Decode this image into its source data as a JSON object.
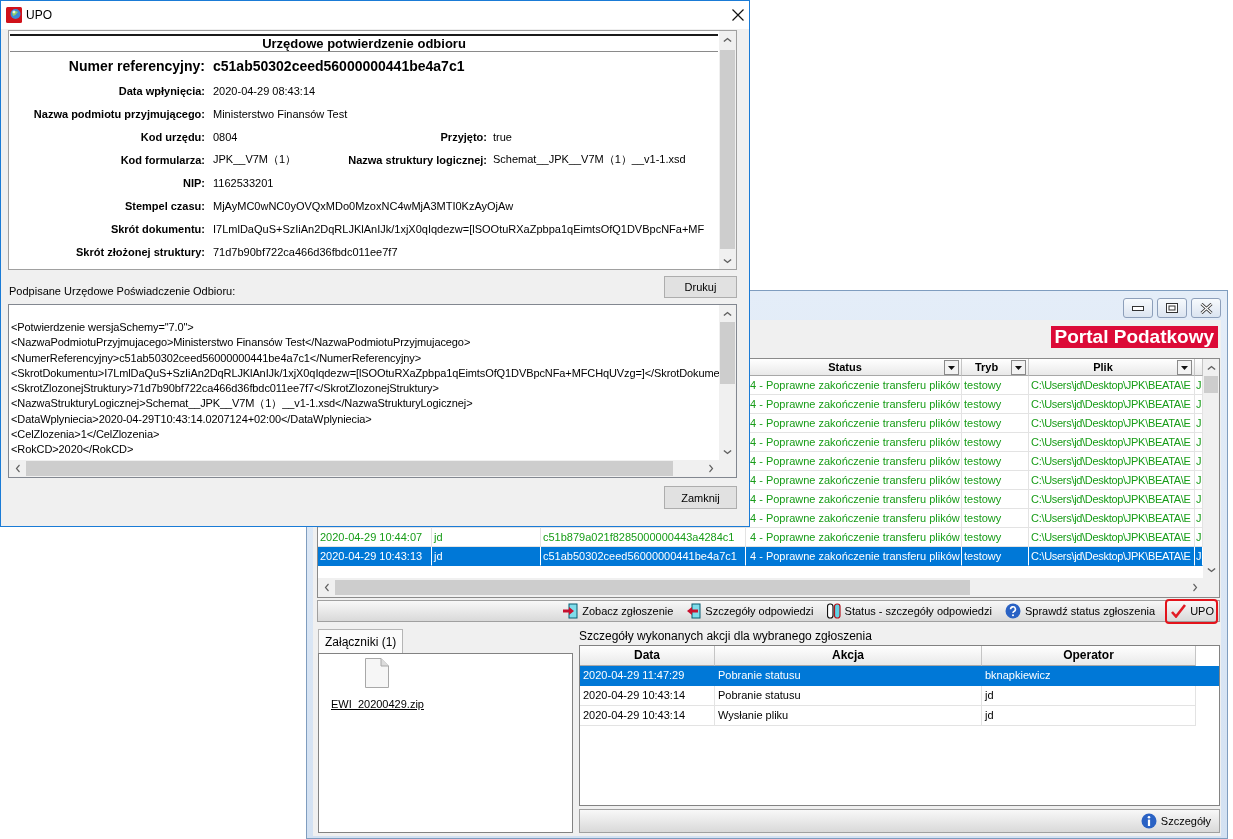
{
  "main_window": {
    "brand": "Portal Podatkowy",
    "submissions": {
      "columns": [
        {
          "label": "Status",
          "filter": true
        },
        {
          "label": "Tryb",
          "filter": true
        },
        {
          "label": "Plik",
          "filter": true
        }
      ],
      "rows": [
        {
          "status": "4 - Poprawne zakończenie transferu plików",
          "tryb": "testowy",
          "plik": "C:\\Users\\jd\\Desktop\\JPK\\BEATA\\E",
          "column_7": "J",
          "selected": false
        },
        {
          "status": "4 - Poprawne zakończenie transferu plików",
          "tryb": "testowy",
          "plik": "C:\\Users\\jd\\Desktop\\JPK\\BEATA\\E",
          "column_7": "J",
          "selected": false
        },
        {
          "status": "4 - Poprawne zakończenie transferu plików",
          "tryb": "testowy",
          "plik": "C:\\Users\\jd\\Desktop\\JPK\\BEATA\\E",
          "column_7": "J",
          "selected": false
        },
        {
          "status": "4 - Poprawne zakończenie transferu plików",
          "tryb": "testowy",
          "plik": "C:\\Users\\jd\\Desktop\\JPK\\BEATA\\E",
          "column_7": "J",
          "selected": false
        },
        {
          "status": "4 - Poprawne zakończenie transferu plików",
          "tryb": "testowy",
          "plik": "C:\\Users\\jd\\Desktop\\JPK\\BEATA\\E",
          "column_7": "J",
          "selected": false
        },
        {
          "status": "4 - Poprawne zakończenie transferu plików",
          "tryb": "testowy",
          "plik": "C:\\Users\\jd\\Desktop\\JPK\\BEATA\\E",
          "column_7": "J",
          "selected": false
        },
        {
          "status": "4 - Poprawne zakończenie transferu plików",
          "tryb": "testowy",
          "plik": "C:\\Users\\jd\\Desktop\\JPK\\BEATA\\E",
          "column_7": "J",
          "selected": false
        },
        {
          "status": "4 - Poprawne zakończenie transferu plików",
          "tryb": "testowy",
          "plik": "C:\\Users\\jd\\Desktop\\JPK\\BEATA\\E",
          "column_7": "J",
          "selected": false
        },
        {
          "column_1": "2020-04-29 10:44:07",
          "column_2": "jd",
          "column_3": "c51b879a021f8285000000443a4284c1",
          "status": "4 - Poprawne zakończenie transferu plików",
          "tryb": "testowy",
          "plik": "C:\\Users\\jd\\Desktop\\JPK\\BEATA\\E",
          "column_7": "J",
          "selected": false
        },
        {
          "column_1": "2020-04-29 10:43:13",
          "column_2": "jd",
          "column_3": "c51ab50302ceed56000000441be4a7c1",
          "status": "4 - Poprawne zakończenie transferu plików",
          "tryb": "testowy",
          "plik": "C:\\Users\\jd\\Desktop\\JPK\\BEATA\\E",
          "column_7": "J",
          "selected": true
        }
      ]
    },
    "actions": [
      {
        "label": "Zobacz zgłoszenie",
        "highlighted": false
      },
      {
        "label": "Szczegóły odpowiedzi",
        "highlighted": false
      },
      {
        "label": "Status - szczegóły odpowiedzi",
        "highlighted": false
      },
      {
        "label": "Sprawdź status zgłoszenia",
        "highlighted": false
      },
      {
        "label": "UPO",
        "highlighted": true
      }
    ],
    "attachments": {
      "tabs": [
        {
          "label": "Załączniki (1)",
          "selected": true
        }
      ],
      "files": [
        "EWI_20200429.zip"
      ]
    },
    "history": {
      "caption": "Szczegóły wykonanych akcji dla wybranego zgłoszenia",
      "columns": [
        "Data",
        "Akcja",
        "Operator"
      ],
      "rows": [
        {
          "data": "2020-04-29 11:47:29",
          "akcja": "Pobranie statusu",
          "operator": "bknapkiewicz",
          "selected": true
        },
        {
          "data": "2020-04-29 10:43:14",
          "akcja": "Pobranie statusu",
          "operator": "jd",
          "selected": false
        },
        {
          "data": "2020-04-29 10:43:14",
          "akcja": "Wysłanie pliku",
          "operator": "jd",
          "selected": false
        }
      ]
    },
    "details_button": "Szczegóły"
  },
  "upo_dialog": {
    "title": "UPO",
    "receipt": {
      "heading": "Urzędowe potwierdzenie odbioru",
      "reference": {
        "label": "Numer referencyjny:",
        "value": "c51ab50302ceed56000000441be4a7c1"
      },
      "fields": [
        {
          "label": "Data wpłynięcia:",
          "value": "2020-04-29 08:43:14"
        },
        {
          "label": "Nazwa podmiotu przyjmującego:",
          "value": "Ministerstwo Finansów Test"
        },
        {
          "label": "Kod urzędu:",
          "value": "0804",
          "second": {
            "label": "Przyjęto:",
            "value": "true"
          }
        },
        {
          "label": "Kod formularza:",
          "value": "JPK__V7M（1）",
          "second": {
            "label": "Nazwa struktury logicznej:",
            "value": "Schemat__JPK__V7M（1）__v1-1.xsd"
          }
        },
        {
          "label": "NIP:",
          "value": "1162533201"
        },
        {
          "label": "Stempel czasu:",
          "value": "MjAyMC0wNC0yOVQxMDo0MzoxNC4wMjA3MTI0KzAyOjAw"
        },
        {
          "label": "Skrót dokumentu:",
          "value": "I7LmlDaQuS+SzIiAn2DqRLJKlAnIJk/1xjX0qIqdezw=[lSOOtuRXaZpbpa1qEimtsOfQ1DVBpcNFa+MF"
        },
        {
          "label": "Skrót złożonej struktury:",
          "value": "71d7b90bf722ca466d36fbdc011ee7f7"
        }
      ]
    },
    "signed_label": "Podpisane Urzędowe Poświadczenie Odbioru:",
    "print_button": "Drukuj",
    "xml_lines": [
      "<Potwierdzenie wersjaSchemy=\"7.0\">",
      "<NazwaPodmiotuPrzyjmujacego>Ministerstwo Finansów Test</NazwaPodmiotuPrzyjmujacego>",
      "<NumerReferencyjny>c51ab50302ceed56000000441be4a7c1</NumerReferencyjny>",
      "<SkrotDokumentu>I7LmlDaQuS+SzIiAn2DqRLJKlAnIJk/1xjX0qIqdezw=[lSOOtuRXaZpbpa1qEimtsOfQ1DVBpcNFa+MFCHqUVzg=]</SkrotDokume",
      "<SkrotZlozonejStruktury>71d7b90bf722ca466d36fbdc011ee7f7</SkrotZlozonejStruktury>",
      "<NazwaStrukturyLogicznej>Schemat__JPK__V7M（1）__v1-1.xsd</NazwaStrukturyLogicznej>",
      "<DataWplyniecia>2020-04-29T10:43:14.0207124+02:00</DataWplyniecia>",
      "<CelZlozenia>1</CelZlozenia>",
      "<RokCD>2020</RokCD>"
    ],
    "close_button": "Zamknij"
  }
}
